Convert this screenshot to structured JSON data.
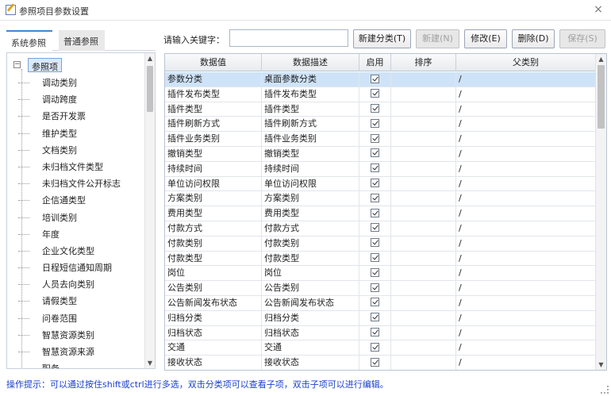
{
  "window": {
    "title": "参照项目参数设置",
    "close_glyph": "×"
  },
  "left_tabs": [
    {
      "label": "系统参照",
      "active": true
    },
    {
      "label": "普通参照",
      "active": false
    }
  ],
  "tree": {
    "expander_glyph": "−",
    "root_label": "参照项",
    "items": [
      "调动类别",
      "调动跨度",
      "是否开发票",
      "维护类型",
      "文档类别",
      "未归档文件类型",
      "未归档文件公开标志",
      "企信通类型",
      "培训类别",
      "年度",
      "企业文化类型",
      "日程短信通知周期",
      "人员去向类别",
      "请假类型",
      "问卷范围",
      "智慧资源类别",
      "智慧资源来源",
      "职务"
    ]
  },
  "toolbar": {
    "keyword_label": "请输入关键字：",
    "keyword_value": "",
    "buttons": {
      "new_category": "新建分类(T)",
      "new": "新建(N)",
      "edit": "修改(E)",
      "delete": "删除(D)",
      "save": "保存(S)"
    }
  },
  "grid": {
    "columns": [
      "数据值",
      "数据描述",
      "启用",
      "排序",
      "父类别"
    ],
    "rows": [
      {
        "value": "参数分类",
        "desc": "桌面参数分类",
        "enabled": true,
        "order": "",
        "parent": "/",
        "selected": true
      },
      {
        "value": "插件发布类型",
        "desc": "插件发布类型",
        "enabled": true,
        "order": "",
        "parent": "/"
      },
      {
        "value": "插件类型",
        "desc": "插件类型",
        "enabled": true,
        "order": "",
        "parent": "/"
      },
      {
        "value": "插件刷新方式",
        "desc": "插件刷新方式",
        "enabled": true,
        "order": "",
        "parent": "/"
      },
      {
        "value": "插件业务类别",
        "desc": "插件业务类别",
        "enabled": true,
        "order": "",
        "parent": "/"
      },
      {
        "value": "撤销类型",
        "desc": "撤销类型",
        "enabled": true,
        "order": "",
        "parent": "/"
      },
      {
        "value": "持续时间",
        "desc": "持续时间",
        "enabled": true,
        "order": "",
        "parent": "/"
      },
      {
        "value": "单位访问权限",
        "desc": "单位访问权限",
        "enabled": true,
        "order": "",
        "parent": "/"
      },
      {
        "value": "方案类别",
        "desc": "方案类别",
        "enabled": true,
        "order": "",
        "parent": "/"
      },
      {
        "value": "费用类型",
        "desc": "费用类型",
        "enabled": true,
        "order": "",
        "parent": "/"
      },
      {
        "value": "付款方式",
        "desc": "付款方式",
        "enabled": true,
        "order": "",
        "parent": "/"
      },
      {
        "value": "付款类别",
        "desc": "付款类别",
        "enabled": true,
        "order": "",
        "parent": "/"
      },
      {
        "value": "付款类型",
        "desc": "付款类型",
        "enabled": true,
        "order": "",
        "parent": "/"
      },
      {
        "value": "岗位",
        "desc": "岗位",
        "enabled": true,
        "order": "",
        "parent": "/"
      },
      {
        "value": "公告类别",
        "desc": "公告类别",
        "enabled": true,
        "order": "",
        "parent": "/"
      },
      {
        "value": "公告新闻发布状态",
        "desc": "公告新闻发布状态",
        "enabled": true,
        "order": "",
        "parent": "/"
      },
      {
        "value": "归档分类",
        "desc": "归档分类",
        "enabled": true,
        "order": "",
        "parent": "/"
      },
      {
        "value": "归档状态",
        "desc": "归档状态",
        "enabled": true,
        "order": "",
        "parent": "/"
      },
      {
        "value": "交通",
        "desc": "交通",
        "enabled": true,
        "order": "",
        "parent": "/"
      },
      {
        "value": "接收状态",
        "desc": "接收状态",
        "enabled": true,
        "order": "",
        "parent": "/"
      }
    ]
  },
  "hint": "操作提示：可以通过按住shift或ctrl进行多选，双击分类项可以查看子项，双击子项可以进行编辑。"
}
